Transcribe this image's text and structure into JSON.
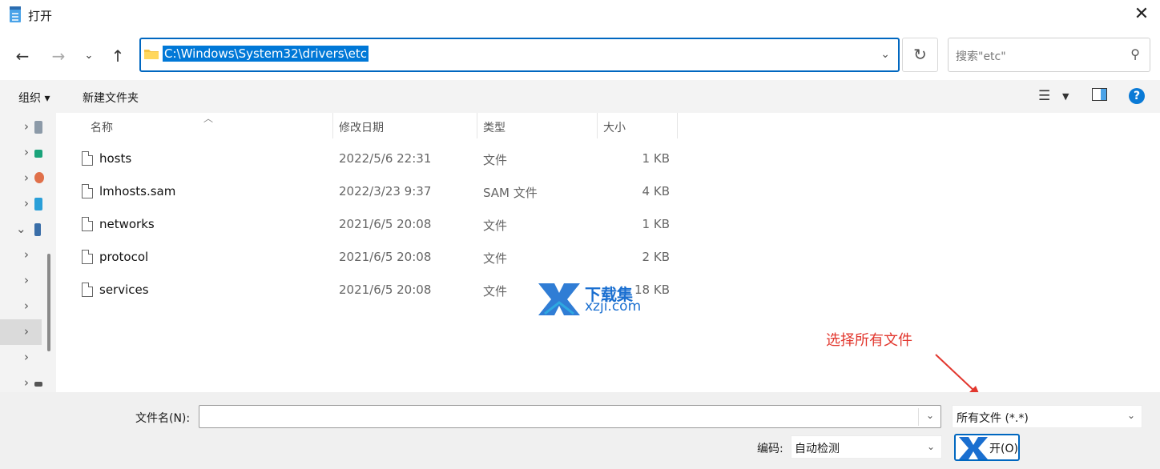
{
  "window": {
    "title": "打开"
  },
  "nav": {
    "path": "C:\\Windows\\System32\\drivers\\etc",
    "search_placeholder": "搜索\"etc\""
  },
  "toolbar": {
    "organize": "组织",
    "new_folder": "新建文件夹"
  },
  "columns": {
    "name": "名称",
    "modified": "修改日期",
    "type": "类型",
    "size": "大小"
  },
  "files": [
    {
      "name": "hosts",
      "date": "2022/5/6 22:31",
      "type": "文件",
      "size": "1 KB"
    },
    {
      "name": "lmhosts.sam",
      "date": "2022/3/23 9:37",
      "type": "SAM 文件",
      "size": "4 KB"
    },
    {
      "name": "networks",
      "date": "2021/6/5 20:08",
      "type": "文件",
      "size": "1 KB"
    },
    {
      "name": "protocol",
      "date": "2021/6/5 20:08",
      "type": "文件",
      "size": "2 KB"
    },
    {
      "name": "services",
      "date": "2021/6/5 20:08",
      "type": "文件",
      "size": "18 KB"
    }
  ],
  "watermark": {
    "line1": "下载集",
    "line2": "xzji.com"
  },
  "annotation": {
    "text": "选择所有文件",
    "color": "#e2372e"
  },
  "footer": {
    "filename_label": "文件名(N):",
    "filename_value": "",
    "filetype_value": "所有文件  (*.*)",
    "encoding_label": "编码:",
    "encoding_value": "自动检测",
    "open_label": "开(O)"
  },
  "colors": {
    "accent": "#0067c0",
    "selection": "#0078d7",
    "help": "#0a7ad6"
  }
}
